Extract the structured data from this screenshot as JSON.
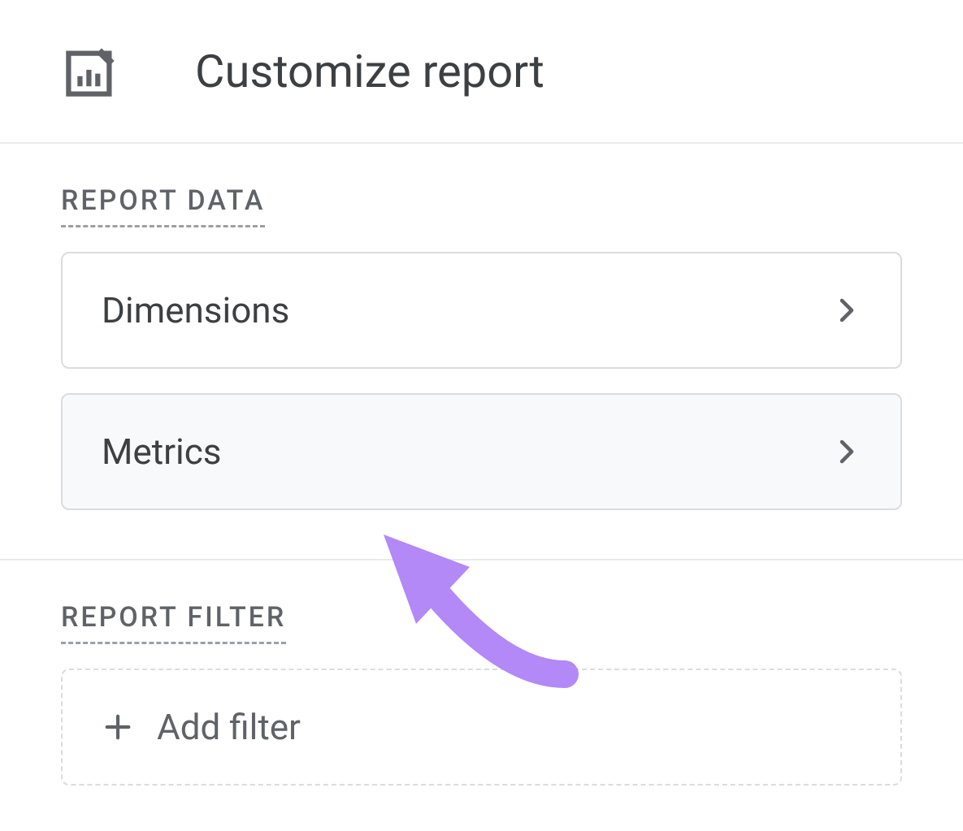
{
  "header": {
    "title": "Customize report"
  },
  "sections": {
    "report_data": {
      "label": "REPORT DATA",
      "items": {
        "dimensions": {
          "label": "Dimensions"
        },
        "metrics": {
          "label": "Metrics"
        }
      }
    },
    "report_filter": {
      "label": "REPORT FILTER",
      "add_filter_label": "Add filter"
    }
  }
}
